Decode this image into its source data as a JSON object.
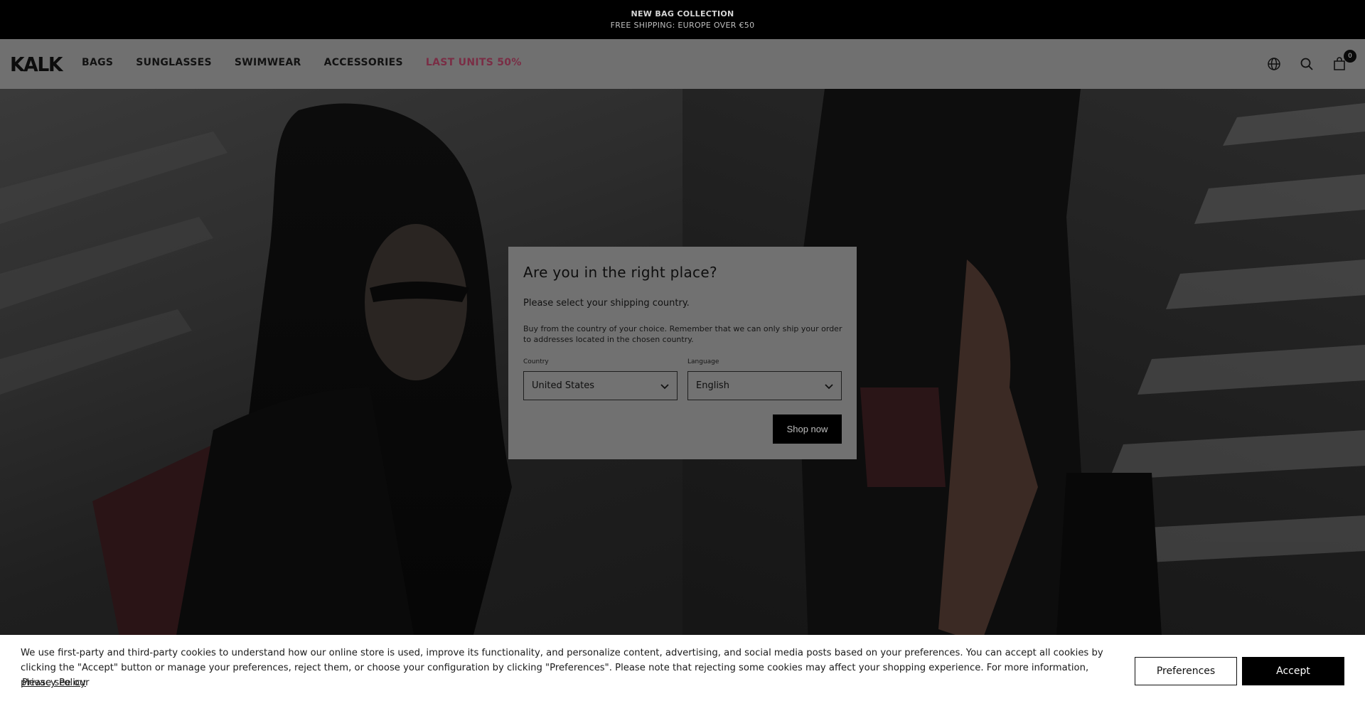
{
  "announcement": {
    "line1": "NEW BAG COLLECTION",
    "line2": "FREE SHIPPING: EUROPE OVER €50"
  },
  "header": {
    "logo": "KALK",
    "nav": [
      {
        "label": "BAGS"
      },
      {
        "label": "SUNGLASSES"
      },
      {
        "label": "SWIMWEAR"
      },
      {
        "label": "ACCESSORIES"
      },
      {
        "label": "LAST UNITS 50%"
      }
    ],
    "icons": [
      "globe-icon",
      "search-icon",
      "cart-icon"
    ],
    "cart_count": "0",
    "sale_color": "#7a2d45"
  },
  "modal": {
    "title": "Are you in the right place?",
    "subtitle": "Please select your shipping country.",
    "note": "Buy from the country of your choice. Remember that we can only ship your order to addresses located in the chosen country.",
    "country_label": "Country",
    "country_value": "United States",
    "language_label": "Language",
    "language_value": "English",
    "shop_button": "Shop now"
  },
  "cookie": {
    "text": "We use first-party and third-party cookies to understand how our online store is used, improve its functionality, and personalize content, advertising, and social media posts based on your preferences. You can accept all cookies by clicking the \"Accept\" button or manage your preferences, reject them, or choose your configuration by clicking \"Preferences\". Please note that rejecting some cookies may affect your shopping experience. For more information, please see our",
    "policy_link": "Privacy Policy",
    "preferences_button": "Preferences",
    "accept_button": "Accept"
  }
}
